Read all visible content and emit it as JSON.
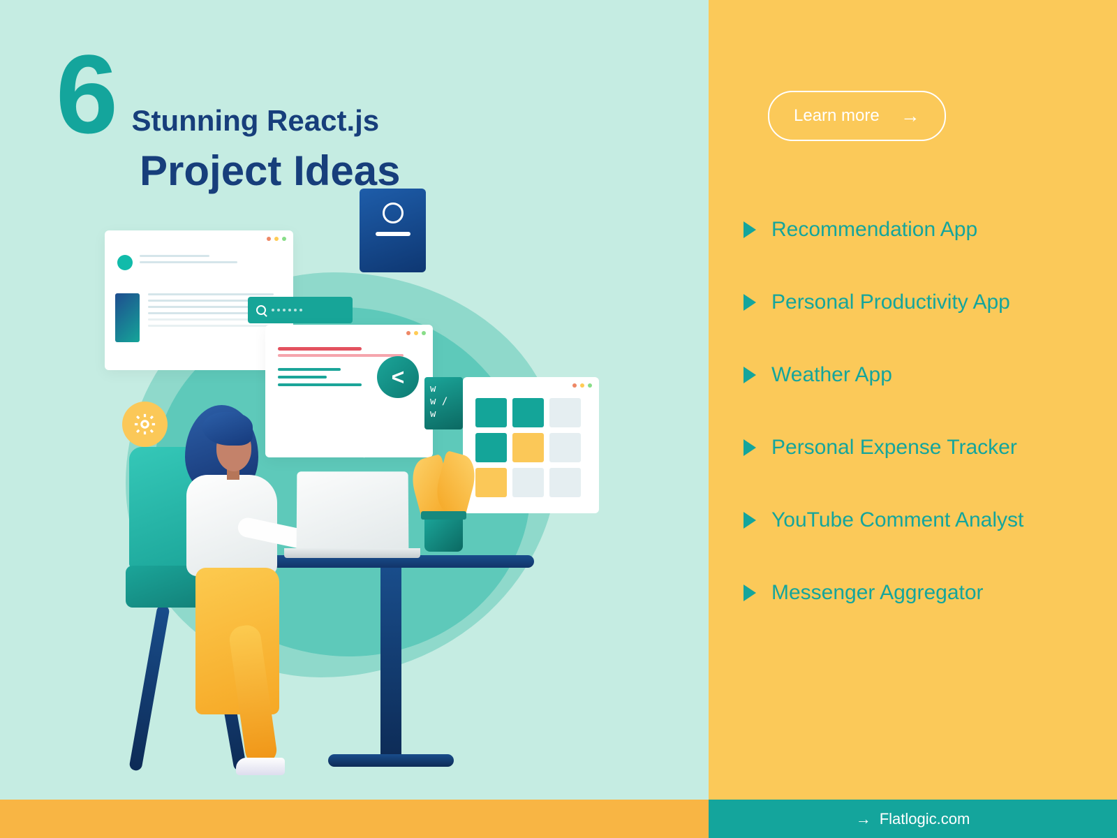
{
  "heading": {
    "number": "6",
    "line1": "Stunning React.js",
    "line2": "Project Ideas"
  },
  "cta": {
    "label": "Learn more"
  },
  "ideas": [
    "Recommendation App",
    "Personal Productivity App",
    "Weather App",
    "Personal Expense Tracker",
    "YouTube Comment Analyst",
    "Messenger Aggregator"
  ],
  "illustration": {
    "www_text": "w\nw /\nw",
    "code_symbol": "<",
    "angle_symbols": "/\n>"
  },
  "footer": {
    "brand": "Flatlogic.com"
  }
}
